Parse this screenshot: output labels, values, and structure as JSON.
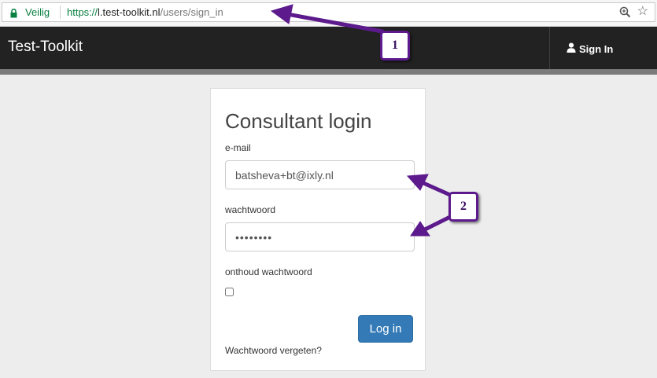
{
  "browser": {
    "secure_label": "Veilig",
    "url_scheme": "https://",
    "url_host": "l.test-toolkit.nl",
    "url_path": "/users/sign_in",
    "icons": [
      "lock-icon",
      "zoom-icon",
      "star-icon"
    ]
  },
  "navbar": {
    "brand": "Test-Toolkit",
    "signin_label": "Sign In",
    "icon": "user-icon"
  },
  "form": {
    "title": "Consultant login",
    "email_label": "e-mail",
    "email_value": "batsheva+bt@ixly.nl",
    "password_label": "wachtwoord",
    "password_value": "••••••••",
    "remember_label": "onthoud wachtwoord",
    "remember_checked": false,
    "submit_label": "Log in",
    "forgot_link": "Wachtwoord vergeten?"
  },
  "annotations": {
    "badge1": "1",
    "badge2": "2",
    "color": "#5c1a8c"
  }
}
